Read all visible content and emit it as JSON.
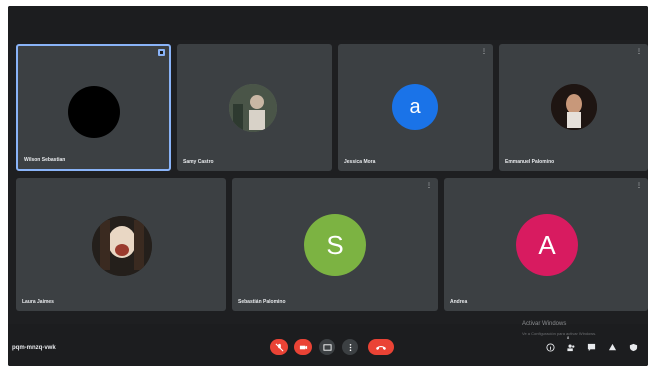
{
  "participants": [
    {
      "name": "Wilson Sebastian",
      "initial": "",
      "avatar_color": "#000000",
      "corner": "",
      "pinned": true
    },
    {
      "name": "Samy Castro",
      "initial": "",
      "avatar_color": "#5f6b5e",
      "corner": "",
      "pinned": false
    },
    {
      "name": "Jessica Mora",
      "initial": "a",
      "avatar_color": "#1a73e8",
      "corner": "⋮",
      "pinned": false
    },
    {
      "name": "Emmanuel Palomino",
      "initial": "",
      "avatar_color": "#2a1d1a",
      "corner": "⋮",
      "pinned": false
    },
    {
      "name": "Laura Jaimes",
      "initial": "",
      "avatar_color": "#2b2621",
      "corner": "",
      "pinned": false
    },
    {
      "name": "Sebastián Palomino",
      "initial": "S",
      "avatar_color": "#7cb342",
      "corner": "⋮",
      "pinned": false
    },
    {
      "name": "Andrea",
      "initial": "A",
      "avatar_color": "#d81b60",
      "corner": "⋮",
      "pinned": false
    }
  ],
  "meeting": {
    "code": "pqm-mnzq-vwk"
  },
  "watermark": {
    "line1": "Activar Windows",
    "line2": "Ve a Configuración para activar Windows."
  },
  "badge_count": "8",
  "controls": {
    "mic": "mic-off-icon",
    "camera": "camera-off-icon",
    "captions": "captions-icon",
    "more": "more-icon",
    "leave": "leave-call-icon"
  },
  "colors": {
    "accent": "#8ab4f8",
    "danger": "#ea4335",
    "tile": "#3c4043",
    "background": "#1e1f21"
  }
}
